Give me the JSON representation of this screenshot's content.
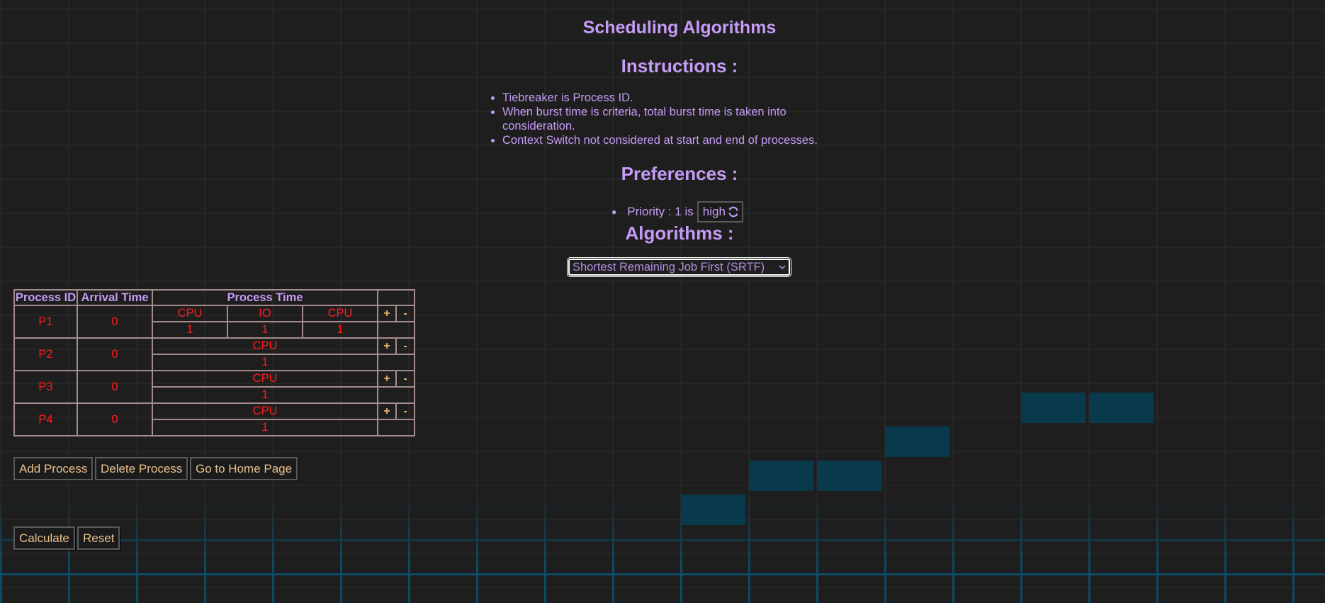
{
  "title": "Scheduling Algorithms",
  "instructions": {
    "heading": "Instructions :",
    "items": [
      "Tiebreaker is Process ID.",
      "When burst time is criteria, total burst time is taken into consideration.",
      "Context Switch not considered at start and end of processes."
    ]
  },
  "preferences": {
    "heading": "Preferences :",
    "priority_label": "Priority : 1 is",
    "priority_value": "high",
    "toggle_icon": "refresh-icon"
  },
  "algorithms": {
    "heading": "Algorithms :",
    "selected": "Shortest Remaining Job First (SRTF)"
  },
  "table": {
    "headers": {
      "pid": "Process ID",
      "arrival": "Arrival Time",
      "ptime": "Process Time"
    },
    "add_symbol": "+",
    "remove_symbol": "-",
    "rows": [
      {
        "pid": "P1",
        "arrival": "0",
        "bursts": [
          {
            "type": "CPU",
            "time": "1"
          },
          {
            "type": "IO",
            "time": "1"
          },
          {
            "type": "CPU",
            "time": "1"
          }
        ]
      },
      {
        "pid": "P2",
        "arrival": "0",
        "bursts": [
          {
            "type": "CPU",
            "time": "1"
          }
        ]
      },
      {
        "pid": "P3",
        "arrival": "0",
        "bursts": [
          {
            "type": "CPU",
            "time": "1"
          }
        ]
      },
      {
        "pid": "P4",
        "arrival": "0",
        "bursts": [
          {
            "type": "CPU",
            "time": "1"
          }
        ]
      }
    ]
  },
  "buttons": {
    "add_process": "Add Process",
    "delete_process": "Delete Process",
    "home": "Go to Home Page",
    "calculate": "Calculate",
    "reset": "Reset"
  },
  "colors": {
    "heading": "#c59cf5",
    "table_values": "#ff1c1c",
    "button_text": "#e9c08a",
    "background": "#1e1e1e",
    "tile": "#083a4b"
  }
}
